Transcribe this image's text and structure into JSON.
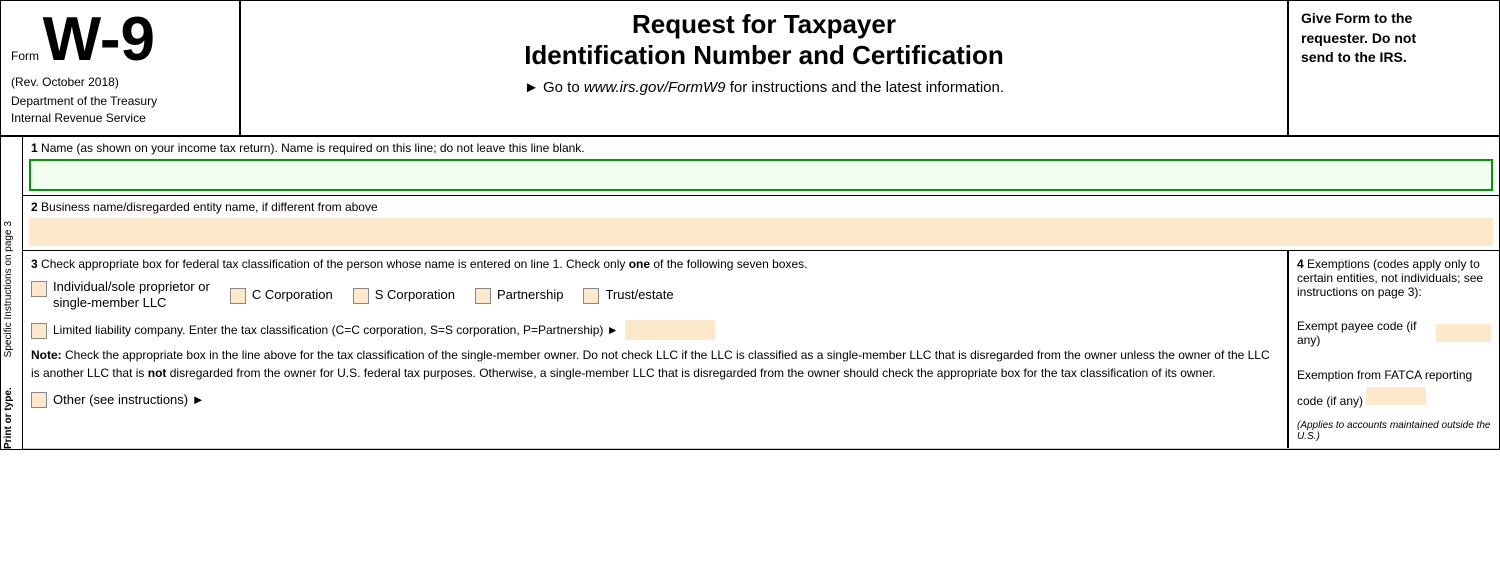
{
  "header": {
    "form_label": "Form",
    "form_number": "W-9",
    "rev_date": "(Rev. October 2018)",
    "dept_line1": "Department of the Treasury",
    "dept_line2": "Internal Revenue Service",
    "main_title_line1": "Request for Taxpayer",
    "main_title_line2": "Identification Number and Certification",
    "subtitle_part1": "► Go to ",
    "subtitle_url": "www.irs.gov/FormW9",
    "subtitle_part2": " for instructions and the latest information.",
    "side_note_line1": "Give Form to the",
    "side_note_line2": "requester. Do not",
    "side_note_line3": "send to the IRS."
  },
  "rotated": {
    "text1": "Print or type.",
    "text2": "Specific Instructions on page 3"
  },
  "fields": {
    "field1_label": "1",
    "field1_desc": "Name (as shown on your income tax return). Name is required on this line; do not leave this line blank.",
    "field2_label": "2",
    "field2_desc": "Business name/disregarded entity name, if different from above"
  },
  "section3": {
    "number": "3",
    "text": "Check appropriate box for federal tax classification of the person whose name is entered on line 1. Check only ",
    "text_bold": "one",
    "text_after": " of the following seven boxes.",
    "checkboxes": [
      {
        "id": "individual",
        "label_line1": "Individual/sole proprietor or",
        "label_line2": "single-member LLC"
      },
      {
        "id": "c-corp",
        "label": "C Corporation"
      },
      {
        "id": "s-corp",
        "label": "S Corporation"
      },
      {
        "id": "partnership",
        "label": "Partnership"
      },
      {
        "id": "trust",
        "label": "Trust/estate"
      }
    ],
    "llc_text": "Limited liability company. Enter the tax classification (C=C corporation, S=S corporation, P=Partnership) ►",
    "note_label": "Note:",
    "note_text": " Check the appropriate box in the line above for the tax classification of the single-member owner.  Do not check LLC if the LLC is classified as a single-member LLC that is disregarded from the owner unless the owner of the LLC is another LLC that is ",
    "note_bold": "not",
    "note_text2": " disregarded from the owner for U.S. federal tax purposes. Otherwise, a single-member LLC that is disregarded from the owner should check the appropriate box for the tax classification of its owner.",
    "other_text": "Other (see instructions) ►"
  },
  "section4": {
    "number": "4",
    "text": "Exemptions (codes apply only to certain entities, not individuals; see instructions on page 3):",
    "exempt_label": "Exempt payee code (if any)",
    "fatca_label": "Exemption from FATCA reporting",
    "fatca_label2": "code (if any)",
    "applies_note": "(Applies to accounts maintained outside the U.S.)"
  }
}
